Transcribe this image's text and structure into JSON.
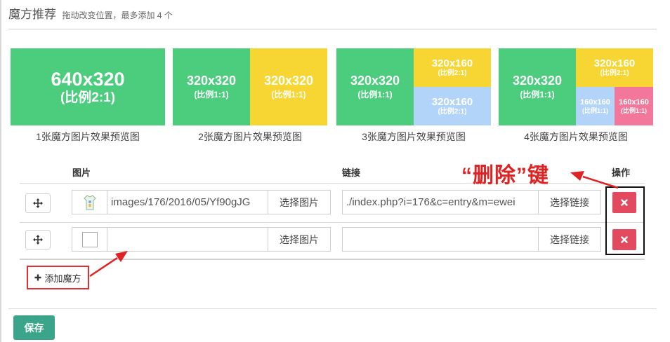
{
  "header": {
    "title": "魔方推荐",
    "hint": "拖动改变位置，最多添加 4 个"
  },
  "previews": [
    {
      "caption": "1张魔方图片效果预览图",
      "blocks": [
        {
          "dim": "640x320",
          "ratio": "(比例2:1)",
          "color": "#4ccd7e"
        }
      ]
    },
    {
      "caption": "2张魔方图片效果预览图",
      "blocks": [
        {
          "dim": "320x320",
          "ratio": "(比例1:1)",
          "color": "#4ccd7e"
        },
        {
          "dim": "320x320",
          "ratio": "(比例1:1)",
          "color": "#f7d633"
        }
      ]
    },
    {
      "caption": "3张魔方图片效果预览图",
      "blocks": [
        {
          "dim": "320x320",
          "ratio": "(比例1:1)",
          "color": "#4ccd7e"
        },
        {
          "dim": "320x160",
          "ratio": "(比例2:1)",
          "color": "#f7d633"
        },
        {
          "dim": "320x160",
          "ratio": "(比例2:1)",
          "color": "#b3d4f9"
        }
      ]
    },
    {
      "caption": "4张魔方图片效果预览图",
      "blocks": [
        {
          "dim": "320x320",
          "ratio": "(比例1:1)",
          "color": "#4ccd7e"
        },
        {
          "dim": "320x160",
          "ratio": "(比例2:1)",
          "color": "#f7d633"
        },
        {
          "dim": "160x160",
          "ratio": "(比例1:1)",
          "color": "#b3d4f9"
        },
        {
          "dim": "160x160",
          "ratio": "(比例1:1)",
          "color": "#f2779b"
        }
      ]
    }
  ],
  "table": {
    "headers": {
      "image": "图片",
      "link": "链接",
      "action": "操作"
    },
    "rows": [
      {
        "image_path": "images/176/2016/05/Yf90gJG",
        "has_thumbnail": true,
        "select_image_label": "选择图片",
        "link_value": "./index.php?i=176&c=entry&m=ewei",
        "select_link_label": "选择链接",
        "drag_icon": "move-icon",
        "delete_icon": "close-icon"
      },
      {
        "image_path": "",
        "has_thumbnail": false,
        "select_image_label": "选择图片",
        "link_value": "",
        "select_link_label": "选择链接",
        "drag_icon": "move-icon",
        "delete_icon": "close-icon"
      }
    ]
  },
  "add_button": {
    "label": "添加魔方",
    "icon": "plus-icon"
  },
  "save_button": {
    "label": "保存"
  },
  "annotation": {
    "text": "“删除”键",
    "color": "#e02222"
  },
  "colors": {
    "green": "#4ccd7e",
    "yellow": "#f7d633",
    "blue": "#b3d4f9",
    "pink": "#f2779b",
    "delete": "#e24a5f",
    "save": "#3aa58a"
  }
}
